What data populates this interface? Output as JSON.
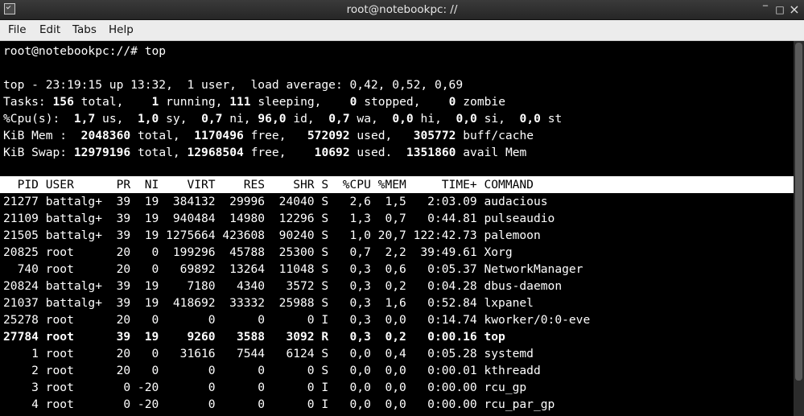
{
  "window": {
    "title": "root@notebookpc: //",
    "minimize": "‾",
    "maximize": "□",
    "close": "×"
  },
  "menu": [
    "File",
    "Edit",
    "Tabs",
    "Help"
  ],
  "prompt": "root@notebookpc://# top",
  "summary": {
    "line1": "top - 23:19:15 up 13:32,  1 user,  load average: 0,42, 0,52, 0,69",
    "tasks": {
      "label": "Tasks:",
      "total": "156",
      "total_l": "total,",
      "running": "1",
      "running_l": "running,",
      "sleeping": "111",
      "sleeping_l": "sleeping,",
      "stopped": "0",
      "stopped_l": "stopped,",
      "zombie": "0",
      "zombie_l": "zombie"
    },
    "cpu": {
      "label": "%Cpu(s):",
      "us": "1,7",
      "us_l": "us,",
      "sy": "1,0",
      "sy_l": "sy,",
      "ni": "0,7",
      "ni_l": "ni,",
      "id": "96,0",
      "id_l": "id,",
      "wa": "0,7",
      "wa_l": "wa,",
      "hi": "0,0",
      "hi_l": "hi,",
      "si": "0,0",
      "si_l": "si,",
      "st": "0,0",
      "st_l": "st"
    },
    "mem": {
      "label": "KiB Mem :",
      "total": "2048360",
      "total_l": "total,",
      "free": "1170496",
      "free_l": "free,",
      "used": "572092",
      "used_l": "used,",
      "cache": "305772",
      "cache_l": "buff/cache"
    },
    "swap": {
      "label": "KiB Swap:",
      "total": "12979196",
      "total_l": "total,",
      "free": "12968504",
      "free_l": "free,",
      "used": "10692",
      "used_l": "used.",
      "avail": "1351860",
      "avail_l": "avail Mem"
    }
  },
  "table": {
    "header": "  PID USER      PR  NI    VIRT    RES    SHR S  %CPU %MEM     TIME+ COMMAND",
    "rows": [
      {
        "text": "21277 battalg+  39  19  384132  29996  24040 S   2,6  1,5   2:03.09 audacious",
        "bold": false
      },
      {
        "text": "21109 battalg+  39  19  940484  14980  12296 S   1,3  0,7   0:44.81 pulseaudio",
        "bold": false
      },
      {
        "text": "21505 battalg+  39  19 1275664 423608  90240 S   1,0 20,7 122:42.73 palemoon",
        "bold": false
      },
      {
        "text": "20825 root      20   0  199296  45788  25300 S   0,7  2,2  39:49.61 Xorg",
        "bold": false
      },
      {
        "text": "  740 root      20   0   69892  13264  11048 S   0,3  0,6   0:05.37 NetworkManager",
        "bold": false
      },
      {
        "text": "20824 battalg+  39  19    7180   4340   3572 S   0,3  0,2   0:04.28 dbus-daemon",
        "bold": false
      },
      {
        "text": "21037 battalg+  39  19  418692  33332  25988 S   0,3  1,6   0:52.84 lxpanel",
        "bold": false
      },
      {
        "text": "25278 root      20   0       0      0      0 I   0,3  0,0   0:14.74 kworker/0:0-eve",
        "bold": false
      },
      {
        "text": "27784 root      39  19    9260   3588   3092 R   0,3  0,2   0:00.16 top",
        "bold": true
      },
      {
        "text": "    1 root      20   0   31616   7544   6124 S   0,0  0,4   0:05.28 systemd",
        "bold": false
      },
      {
        "text": "    2 root      20   0       0      0      0 S   0,0  0,0   0:00.01 kthreadd",
        "bold": false
      },
      {
        "text": "    3 root       0 -20       0      0      0 I   0,0  0,0   0:00.00 rcu_gp",
        "bold": false
      },
      {
        "text": "    4 root       0 -20       0      0      0 I   0,0  0,0   0:00.00 rcu_par_gp",
        "bold": false
      }
    ]
  }
}
